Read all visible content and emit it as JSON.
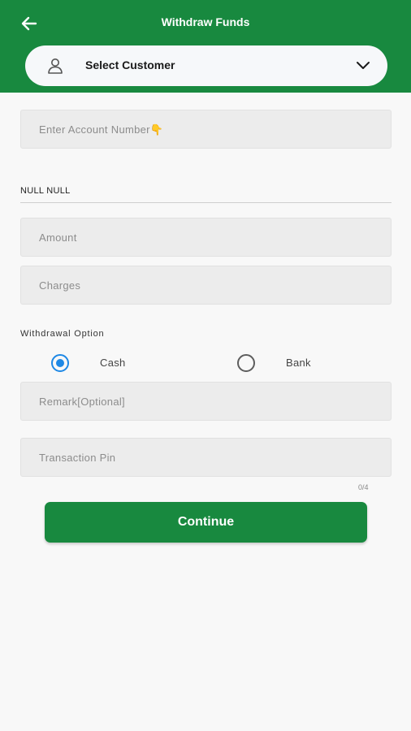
{
  "header": {
    "title": "Withdraw Funds",
    "back_icon": "arrow-left-icon",
    "background": "#18893f"
  },
  "customer_select": {
    "label": "Select Customer",
    "user_icon": "user-icon",
    "chevron_icon": "chevron-down-icon"
  },
  "account_number": {
    "placeholder": "Enter Account Number👇",
    "value": ""
  },
  "account_name": "NULL NULL",
  "amount": {
    "placeholder": "Amount",
    "value": ""
  },
  "charges": {
    "placeholder": "Charges",
    "value": ""
  },
  "withdrawal_option": {
    "title": "Withdrawal Option",
    "options": [
      {
        "label": "Cash",
        "selected": true
      },
      {
        "label": "Bank",
        "selected": false
      }
    ],
    "selected_color": "#1e88e5"
  },
  "remark": {
    "placeholder": "Remark[Optional]",
    "value": ""
  },
  "transaction_pin": {
    "placeholder": "Transaction Pin",
    "value": "",
    "counter": "0/4"
  },
  "continue_button": {
    "label": "Continue",
    "color": "#18893f"
  }
}
